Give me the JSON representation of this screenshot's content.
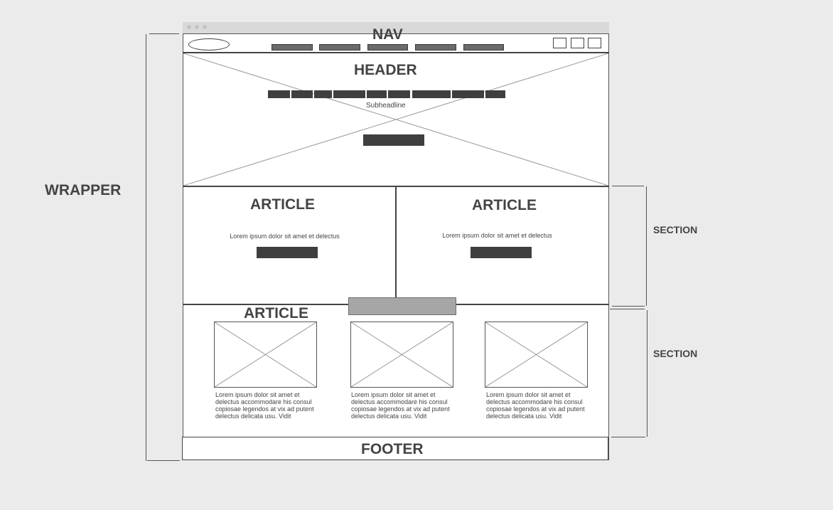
{
  "labels": {
    "wrapper": "WRAPPER",
    "nav": "NAV",
    "header": "HEADER",
    "subheadline": "Subheadline",
    "section_top": "SECTION",
    "section_bottom": "SECTION",
    "footer": "FOOTER"
  },
  "articles": [
    {
      "title": "ARTICLE",
      "text": "Lorem ipsum dolor sit amet et delectus"
    },
    {
      "title": "ARTICLE",
      "text": "Lorem ipsum dolor sit amet et delectus"
    }
  ],
  "bottom_article": {
    "title": "ARTICLE",
    "cards": [
      {
        "text": "Lorem ipsum dolor sit amet et delectus accommodare his consul copiosae legendos at vix ad putent delectus delicata usu. Vidit"
      },
      {
        "text": "Lorem ipsum dolor sit amet et delectus accommodare his consul copiosae legendos at vix ad putent delectus delicata usu. Vidit"
      },
      {
        "text": "Lorem ipsum dolor sit amet et delectus accommodare his consul copiosae legendos at vix ad putent delectus delicata usu. Vidit"
      }
    ]
  },
  "icons": {
    "logo": "logo-oval-icon",
    "window_dots": "window-dots-icon",
    "nav_boxes": "nav-box-icon",
    "image_placeholder": "image-placeholder-icon"
  },
  "colors": {
    "background": "#ebebeb",
    "frame": "#ffffff",
    "lines": "#555555",
    "dark_block": "#3f3f3f",
    "gray_block": "#a6a6a6"
  }
}
